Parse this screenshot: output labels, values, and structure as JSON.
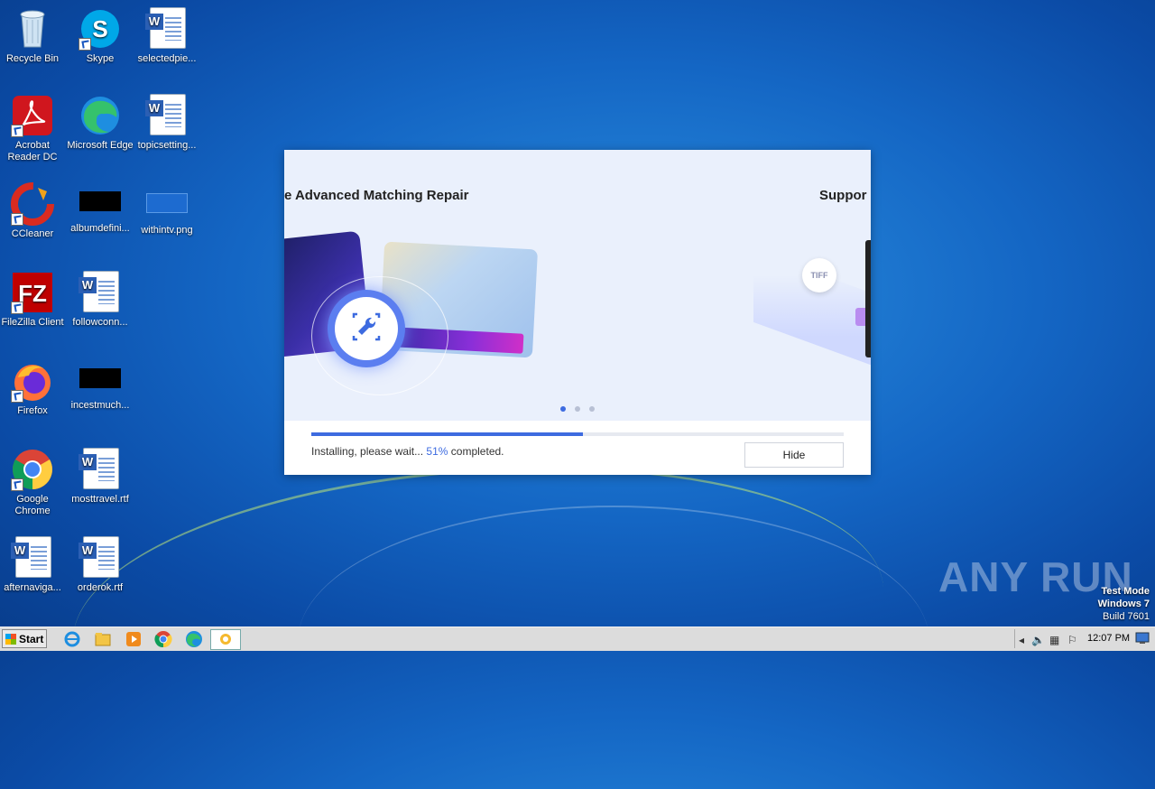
{
  "desktop": {
    "icons": [
      {
        "label": "Recycle Bin"
      },
      {
        "label": "Skype"
      },
      {
        "label": "selectedpie..."
      },
      {
        "label": "Acrobat Reader DC"
      },
      {
        "label": "Microsoft Edge"
      },
      {
        "label": "topicsetting..."
      },
      {
        "label": "CCleaner"
      },
      {
        "label": "albumdefini..."
      },
      {
        "label": "withintv.png"
      },
      {
        "label": "FileZilla Client"
      },
      {
        "label": "followconn..."
      },
      {
        "label": "Firefox"
      },
      {
        "label": "incestmuch..."
      },
      {
        "label": "Google Chrome"
      },
      {
        "label": "mosttravel.rtf"
      },
      {
        "label": "afternaviga..."
      },
      {
        "label": "orderok.rtf"
      }
    ],
    "watermark": "ANY RUN",
    "test_mode": {
      "line1": "Test Mode",
      "line2": "Windows 7",
      "line3": "Build 7601"
    }
  },
  "installer": {
    "slide_title_main": "e Advanced Matching Repair",
    "slide_title_next": "Suppor",
    "tiff_badge": "TIFF",
    "carousel": {
      "count": 3,
      "active_index": 0
    },
    "progress_fraction": 0.51,
    "status_prefix": "Installing, please wait...",
    "status_percent": "51%",
    "status_suffix": "completed.",
    "hide_label": "Hide"
  },
  "taskbar": {
    "start_label": "Start",
    "clock": "12:07 PM"
  }
}
